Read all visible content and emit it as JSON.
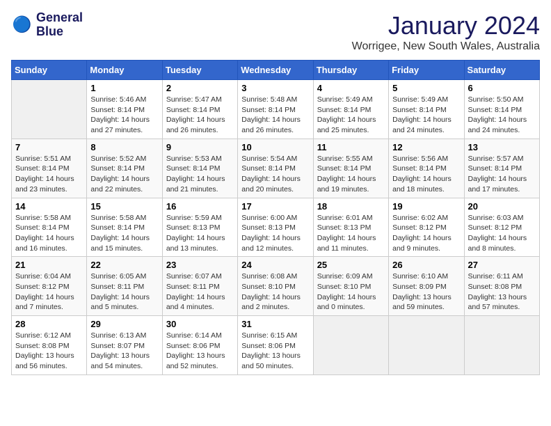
{
  "header": {
    "logo_line1": "General",
    "logo_line2": "Blue",
    "month": "January 2024",
    "location": "Worrigee, New South Wales, Australia"
  },
  "days_of_week": [
    "Sunday",
    "Monday",
    "Tuesday",
    "Wednesday",
    "Thursday",
    "Friday",
    "Saturday"
  ],
  "weeks": [
    [
      {
        "day": "",
        "empty": true
      },
      {
        "day": "1",
        "sunrise": "5:46 AM",
        "sunset": "8:14 PM",
        "daylight": "14 hours and 27 minutes."
      },
      {
        "day": "2",
        "sunrise": "5:47 AM",
        "sunset": "8:14 PM",
        "daylight": "14 hours and 26 minutes."
      },
      {
        "day": "3",
        "sunrise": "5:48 AM",
        "sunset": "8:14 PM",
        "daylight": "14 hours and 26 minutes."
      },
      {
        "day": "4",
        "sunrise": "5:49 AM",
        "sunset": "8:14 PM",
        "daylight": "14 hours and 25 minutes."
      },
      {
        "day": "5",
        "sunrise": "5:49 AM",
        "sunset": "8:14 PM",
        "daylight": "14 hours and 24 minutes."
      },
      {
        "day": "6",
        "sunrise": "5:50 AM",
        "sunset": "8:14 PM",
        "daylight": "14 hours and 24 minutes."
      }
    ],
    [
      {
        "day": "7",
        "sunrise": "5:51 AM",
        "sunset": "8:14 PM",
        "daylight": "14 hours and 23 minutes."
      },
      {
        "day": "8",
        "sunrise": "5:52 AM",
        "sunset": "8:14 PM",
        "daylight": "14 hours and 22 minutes."
      },
      {
        "day": "9",
        "sunrise": "5:53 AM",
        "sunset": "8:14 PM",
        "daylight": "14 hours and 21 minutes."
      },
      {
        "day": "10",
        "sunrise": "5:54 AM",
        "sunset": "8:14 PM",
        "daylight": "14 hours and 20 minutes."
      },
      {
        "day": "11",
        "sunrise": "5:55 AM",
        "sunset": "8:14 PM",
        "daylight": "14 hours and 19 minutes."
      },
      {
        "day": "12",
        "sunrise": "5:56 AM",
        "sunset": "8:14 PM",
        "daylight": "14 hours and 18 minutes."
      },
      {
        "day": "13",
        "sunrise": "5:57 AM",
        "sunset": "8:14 PM",
        "daylight": "14 hours and 17 minutes."
      }
    ],
    [
      {
        "day": "14",
        "sunrise": "5:58 AM",
        "sunset": "8:14 PM",
        "daylight": "14 hours and 16 minutes."
      },
      {
        "day": "15",
        "sunrise": "5:58 AM",
        "sunset": "8:14 PM",
        "daylight": "14 hours and 15 minutes."
      },
      {
        "day": "16",
        "sunrise": "5:59 AM",
        "sunset": "8:13 PM",
        "daylight": "14 hours and 13 minutes."
      },
      {
        "day": "17",
        "sunrise": "6:00 AM",
        "sunset": "8:13 PM",
        "daylight": "14 hours and 12 minutes."
      },
      {
        "day": "18",
        "sunrise": "6:01 AM",
        "sunset": "8:13 PM",
        "daylight": "14 hours and 11 minutes."
      },
      {
        "day": "19",
        "sunrise": "6:02 AM",
        "sunset": "8:12 PM",
        "daylight": "14 hours and 9 minutes."
      },
      {
        "day": "20",
        "sunrise": "6:03 AM",
        "sunset": "8:12 PM",
        "daylight": "14 hours and 8 minutes."
      }
    ],
    [
      {
        "day": "21",
        "sunrise": "6:04 AM",
        "sunset": "8:12 PM",
        "daylight": "14 hours and 7 minutes."
      },
      {
        "day": "22",
        "sunrise": "6:05 AM",
        "sunset": "8:11 PM",
        "daylight": "14 hours and 5 minutes."
      },
      {
        "day": "23",
        "sunrise": "6:07 AM",
        "sunset": "8:11 PM",
        "daylight": "14 hours and 4 minutes."
      },
      {
        "day": "24",
        "sunrise": "6:08 AM",
        "sunset": "8:10 PM",
        "daylight": "14 hours and 2 minutes."
      },
      {
        "day": "25",
        "sunrise": "6:09 AM",
        "sunset": "8:10 PM",
        "daylight": "14 hours and 0 minutes."
      },
      {
        "day": "26",
        "sunrise": "6:10 AM",
        "sunset": "8:09 PM",
        "daylight": "13 hours and 59 minutes."
      },
      {
        "day": "27",
        "sunrise": "6:11 AM",
        "sunset": "8:08 PM",
        "daylight": "13 hours and 57 minutes."
      }
    ],
    [
      {
        "day": "28",
        "sunrise": "6:12 AM",
        "sunset": "8:08 PM",
        "daylight": "13 hours and 56 minutes."
      },
      {
        "day": "29",
        "sunrise": "6:13 AM",
        "sunset": "8:07 PM",
        "daylight": "13 hours and 54 minutes."
      },
      {
        "day": "30",
        "sunrise": "6:14 AM",
        "sunset": "8:06 PM",
        "daylight": "13 hours and 52 minutes."
      },
      {
        "day": "31",
        "sunrise": "6:15 AM",
        "sunset": "8:06 PM",
        "daylight": "13 hours and 50 minutes."
      },
      {
        "day": "",
        "empty": true
      },
      {
        "day": "",
        "empty": true
      },
      {
        "day": "",
        "empty": true
      }
    ]
  ]
}
